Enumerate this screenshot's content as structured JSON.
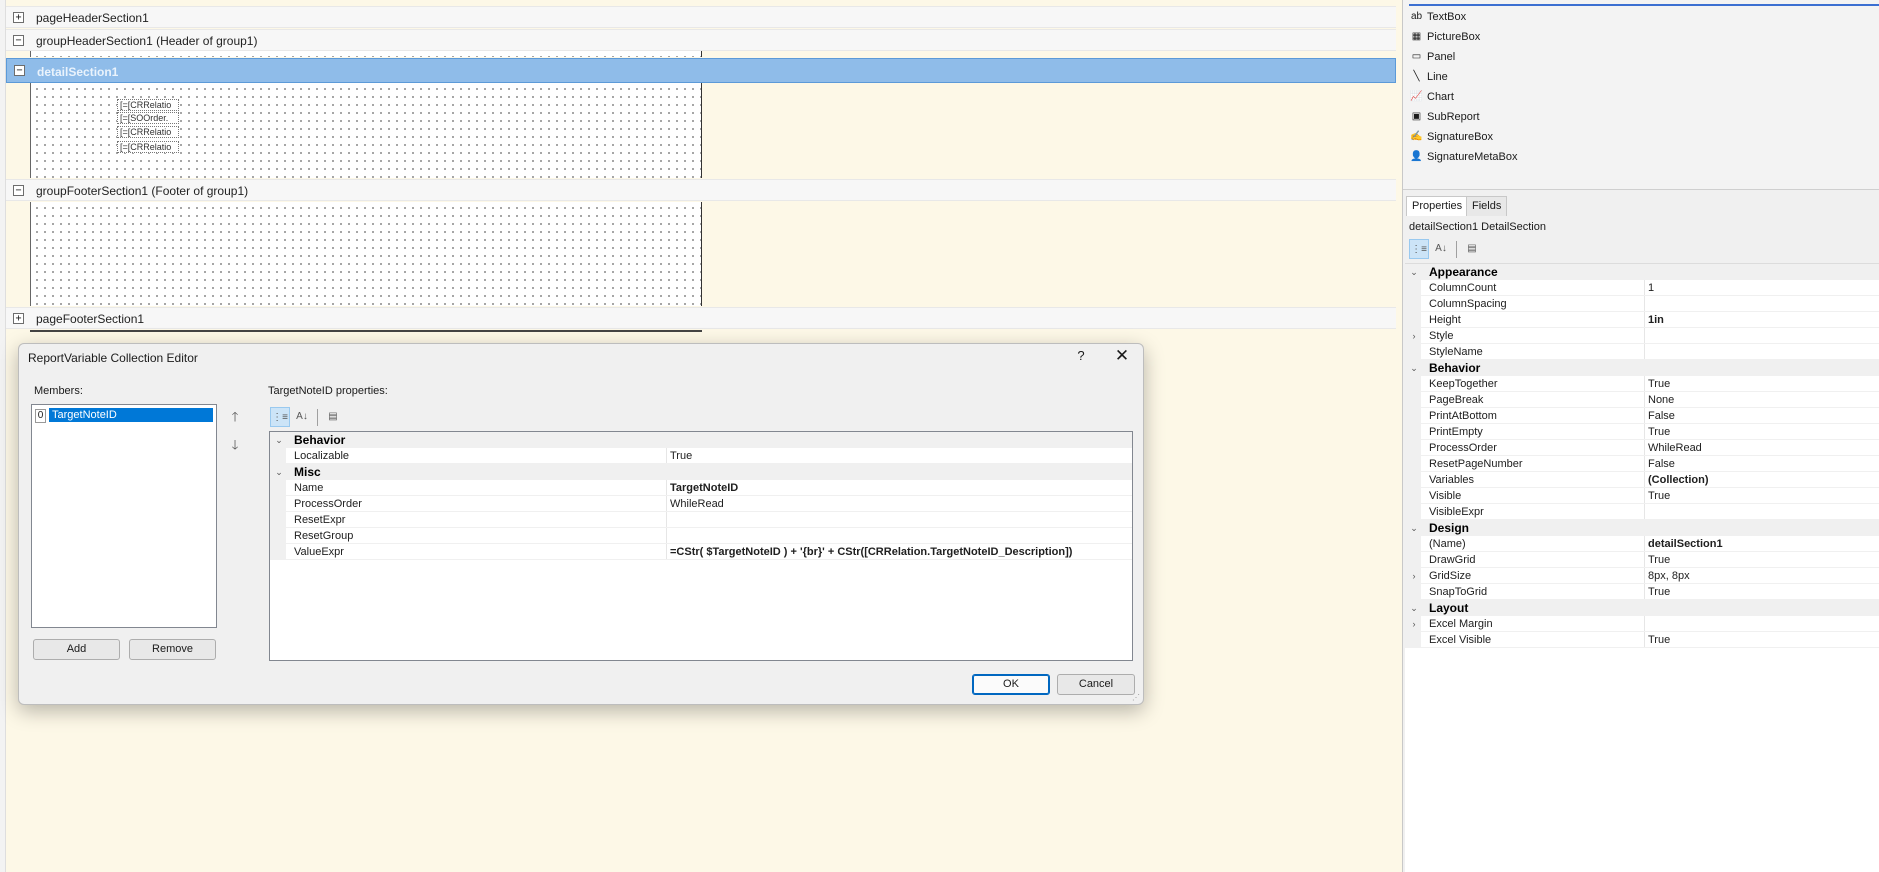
{
  "designer": {
    "bands": [
      {
        "id": "pageHeader",
        "toggle": "+",
        "label": "pageHeaderSection1"
      },
      {
        "id": "groupHeader",
        "toggle": "−",
        "label": "groupHeaderSection1 (Header of group1)"
      },
      {
        "id": "detail",
        "toggle": "−",
        "label": "detailSection1"
      },
      {
        "id": "groupFooter",
        "toggle": "−",
        "label": "groupFooterSection1 (Footer of group1)"
      },
      {
        "id": "pageFooter",
        "toggle": "+",
        "label": "pageFooterSection1"
      }
    ],
    "fields": [
      "[=[CRRelatio",
      "[=[SOOrder.",
      "[=[CRRelatio",
      "[=[CRRelatio"
    ]
  },
  "dialog": {
    "title": "ReportVariable Collection Editor",
    "help": "?",
    "close": "✕",
    "members_label": "Members:",
    "members": [
      {
        "index": "0",
        "name": "TargetNoteID"
      }
    ],
    "move_up": "🡑",
    "move_down": "🡓",
    "add": "Add",
    "remove": "Remove",
    "props_label": "TargetNoteID properties:",
    "ok": "OK",
    "cancel": "Cancel",
    "grid": [
      {
        "type": "cat",
        "name": "Behavior"
      },
      {
        "type": "prop",
        "name": "Localizable",
        "value": "True"
      },
      {
        "type": "cat",
        "name": "Misc"
      },
      {
        "type": "prop",
        "name": "Name",
        "value": "TargetNoteID",
        "bold": true
      },
      {
        "type": "prop",
        "name": "ProcessOrder",
        "value": "WhileRead"
      },
      {
        "type": "prop",
        "name": "ResetExpr",
        "value": ""
      },
      {
        "type": "prop",
        "name": "ResetGroup",
        "value": ""
      },
      {
        "type": "prop",
        "name": "ValueExpr",
        "value": "=CStr( $TargetNoteID ) + '{br}' + CStr([CRRelation.TargetNoteID_Description])",
        "bold": true
      }
    ]
  },
  "toolbox": {
    "items": [
      {
        "icon": "ab",
        "label": "TextBox",
        "icon_name": "textbox-icon"
      },
      {
        "icon": "▦",
        "label": "PictureBox",
        "icon_name": "picturebox-icon"
      },
      {
        "icon": "▭",
        "label": "Panel",
        "icon_name": "panel-icon"
      },
      {
        "icon": "╲",
        "label": "Line",
        "icon_name": "line-icon"
      },
      {
        "icon": "📈",
        "label": "Chart",
        "icon_name": "chart-icon"
      },
      {
        "icon": "▣",
        "label": "SubReport",
        "icon_name": "subreport-icon"
      },
      {
        "icon": "✍",
        "label": "SignatureBox",
        "icon_name": "signaturebox-icon"
      },
      {
        "icon": "👤",
        "label": "SignatureMetaBox",
        "icon_name": "signaturemetabox-icon"
      }
    ]
  },
  "properties_panel": {
    "tabs": [
      "Properties",
      "Fields"
    ],
    "object_label": "detailSection1  DetailSection",
    "grid": [
      {
        "type": "cat",
        "name": "Appearance"
      },
      {
        "type": "prop",
        "name": "ColumnCount",
        "value": "1"
      },
      {
        "type": "prop",
        "name": "ColumnSpacing",
        "value": ""
      },
      {
        "type": "prop",
        "name": "Height",
        "value": "1in",
        "bold": true
      },
      {
        "type": "prop",
        "name": "Style",
        "value": "",
        "expand": true
      },
      {
        "type": "prop",
        "name": "StyleName",
        "value": ""
      },
      {
        "type": "cat",
        "name": "Behavior"
      },
      {
        "type": "prop",
        "name": "KeepTogether",
        "value": "True"
      },
      {
        "type": "prop",
        "name": "PageBreak",
        "value": "None"
      },
      {
        "type": "prop",
        "name": "PrintAtBottom",
        "value": "False"
      },
      {
        "type": "prop",
        "name": "PrintEmpty",
        "value": "True"
      },
      {
        "type": "prop",
        "name": "ProcessOrder",
        "value": "WhileRead"
      },
      {
        "type": "prop",
        "name": "ResetPageNumber",
        "value": "False"
      },
      {
        "type": "prop",
        "name": "Variables",
        "value": "(Collection)",
        "bold": true
      },
      {
        "type": "prop",
        "name": "Visible",
        "value": "True"
      },
      {
        "type": "prop",
        "name": "VisibleExpr",
        "value": ""
      },
      {
        "type": "cat",
        "name": "Design"
      },
      {
        "type": "prop",
        "name": "(Name)",
        "value": "detailSection1",
        "bold": true
      },
      {
        "type": "prop",
        "name": "DrawGrid",
        "value": "True"
      },
      {
        "type": "prop",
        "name": "GridSize",
        "value": "8px, 8px",
        "expand": true
      },
      {
        "type": "prop",
        "name": "SnapToGrid",
        "value": "True"
      },
      {
        "type": "cat",
        "name": "Layout"
      },
      {
        "type": "prop",
        "name": "Excel Margin",
        "value": "",
        "expand": true
      },
      {
        "type": "prop",
        "name": "Excel Visible",
        "value": "True"
      }
    ]
  }
}
